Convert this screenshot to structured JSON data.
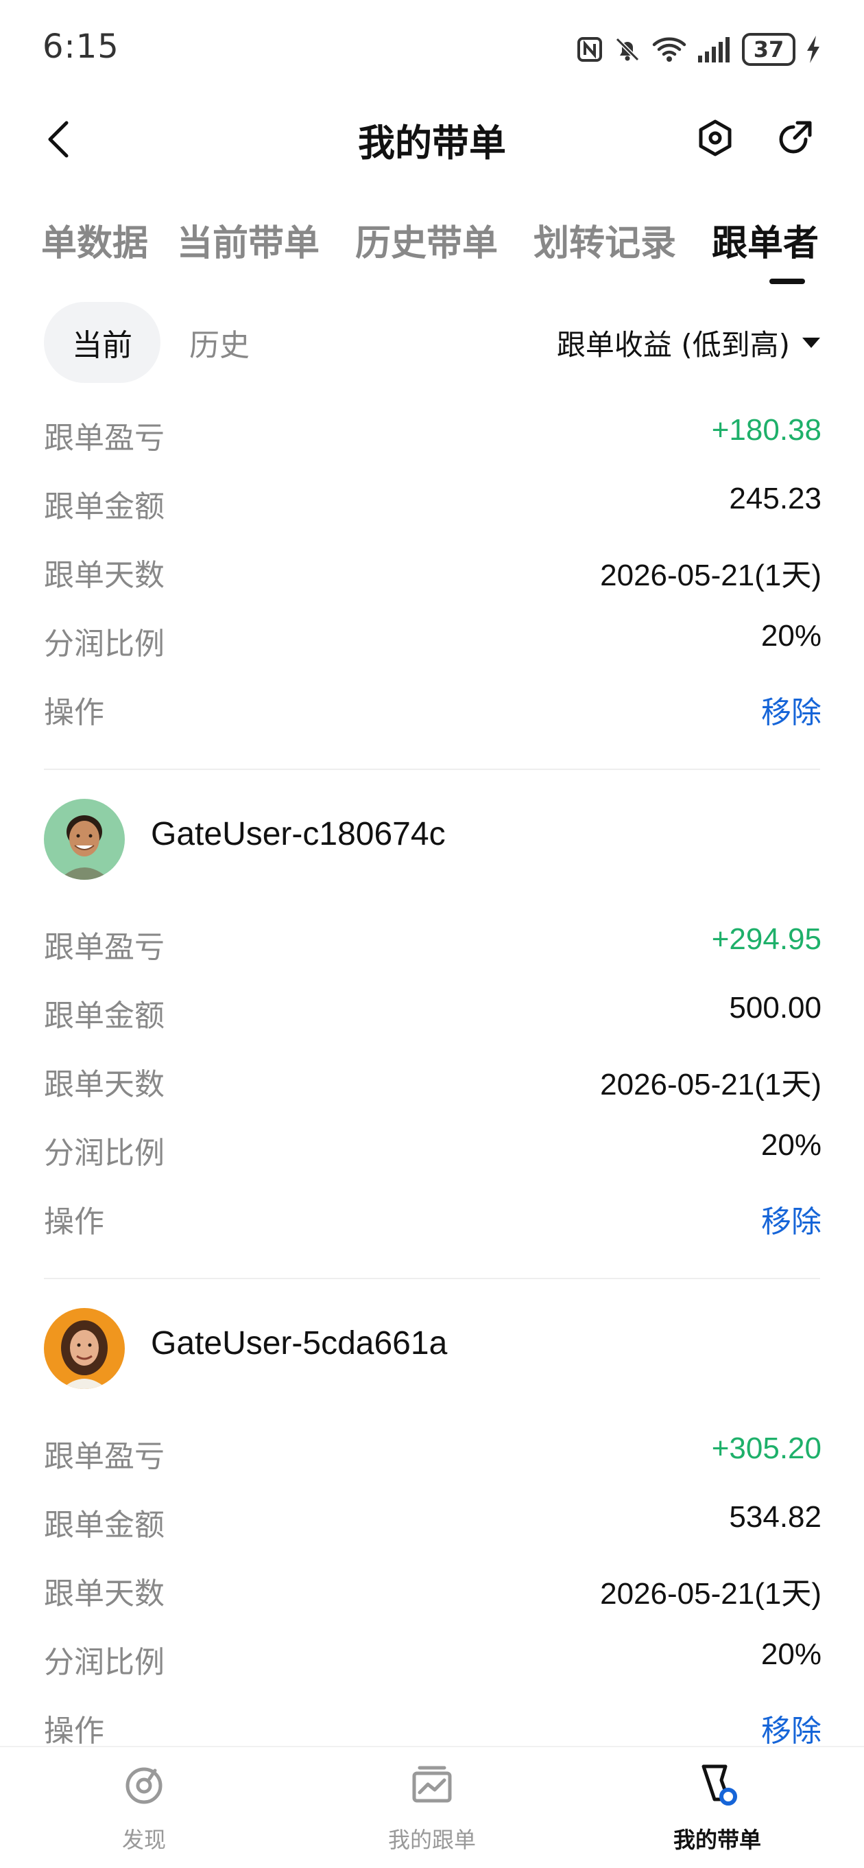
{
  "status_bar": {
    "time": "6:15",
    "battery": "37",
    "icons": [
      "nfc-icon",
      "bell-mute-icon",
      "wifi-icon",
      "signal-icon",
      "battery-icon",
      "charging-icon"
    ]
  },
  "header": {
    "title": "我的带单",
    "icons": [
      "back-arrow-icon",
      "settings-hexagon-icon",
      "share-icon"
    ]
  },
  "tabs": [
    {
      "label": "单数据"
    },
    {
      "label": "当前带单"
    },
    {
      "label": "历史带单"
    },
    {
      "label": "划转记录"
    },
    {
      "label": "跟单者",
      "active": true
    }
  ],
  "sub_tabs": {
    "current": "当前",
    "history": "历史"
  },
  "sort": {
    "label": "跟单收益 (低到高)"
  },
  "labels": {
    "pnl": "跟单盈亏",
    "amount": "跟单金额",
    "days": "跟单天数",
    "share_ratio": "分润比例",
    "operation": "操作",
    "remove": "移除"
  },
  "followers": [
    {
      "username": "",
      "pnl": "+180.38",
      "amount": "245.23",
      "days": "2026-05-21(1天)",
      "share_ratio": "20%"
    },
    {
      "username": "GateUser-c180674c",
      "pnl": "+294.95",
      "amount": "500.00",
      "days": "2026-05-21(1天)",
      "share_ratio": "20%"
    },
    {
      "username": "GateUser-5cda661a",
      "pnl": "+305.20",
      "amount": "534.82",
      "days": "2026-05-21(1天)",
      "share_ratio": "20%"
    }
  ],
  "bottom_nav": [
    {
      "label": "发现",
      "icon": "discover-icon"
    },
    {
      "label": "我的跟单",
      "icon": "chart-icon"
    },
    {
      "label": "我的带单",
      "icon": "lead-icon",
      "active": true
    }
  ],
  "colors": {
    "profit": "#1eb06a",
    "link": "#1665d8",
    "muted": "#888888",
    "text": "#111111"
  }
}
